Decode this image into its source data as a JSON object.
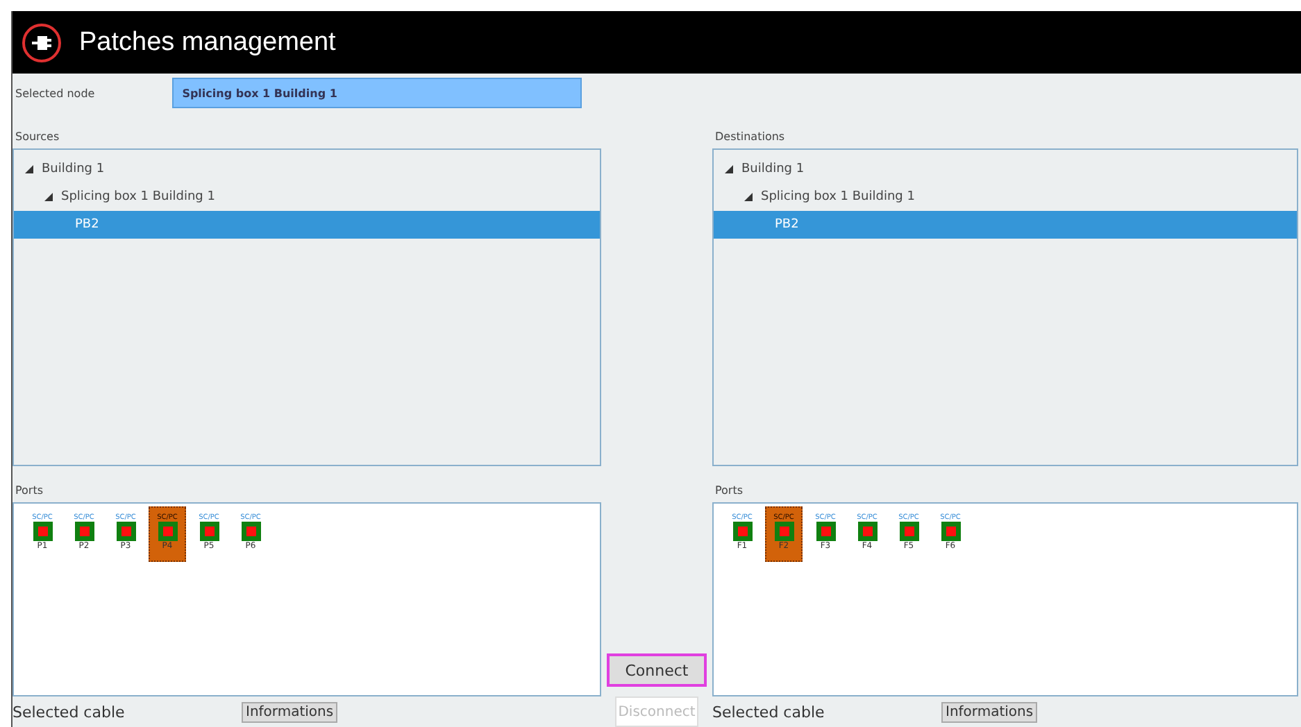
{
  "window": {
    "title": "Patches management"
  },
  "selected_node": {
    "label": "Selected node",
    "value": "Splicing box 1 Building 1"
  },
  "sources": {
    "label": "Sources",
    "tree": [
      {
        "label": "Building 1",
        "expanded": true,
        "selected": false,
        "children": [
          {
            "label": "Splicing box 1 Building 1",
            "expanded": true,
            "selected": false,
            "children": [
              {
                "label": "PB2",
                "selected": true
              }
            ]
          }
        ]
      }
    ],
    "ports_label": "Ports",
    "ports": [
      {
        "type": "SC/PC",
        "label": "P1",
        "selected": false
      },
      {
        "type": "SC/PC",
        "label": "P2",
        "selected": false
      },
      {
        "type": "SC/PC",
        "label": "P3",
        "selected": false
      },
      {
        "type": "SC/PC",
        "label": "P4",
        "selected": true
      },
      {
        "type": "SC/PC",
        "label": "P5",
        "selected": false
      },
      {
        "type": "SC/PC",
        "label": "P6",
        "selected": false
      }
    ],
    "cable_label": "Selected cable",
    "info_button": "Informations"
  },
  "destinations": {
    "label": "Destinations",
    "tree": [
      {
        "label": "Building 1",
        "expanded": true,
        "selected": false,
        "children": [
          {
            "label": "Splicing box 1 Building 1",
            "expanded": true,
            "selected": false,
            "children": [
              {
                "label": "PB2",
                "selected": true
              }
            ]
          }
        ]
      }
    ],
    "ports_label": "Ports",
    "ports": [
      {
        "type": "SC/PC",
        "label": "F1",
        "selected": false
      },
      {
        "type": "SC/PC",
        "label": "F2",
        "selected": true
      },
      {
        "type": "SC/PC",
        "label": "F3",
        "selected": false
      },
      {
        "type": "SC/PC",
        "label": "F4",
        "selected": false
      },
      {
        "type": "SC/PC",
        "label": "F5",
        "selected": false
      },
      {
        "type": "SC/PC",
        "label": "F6",
        "selected": false
      }
    ],
    "cable_label": "Selected cable",
    "info_button": "Informations"
  },
  "connect_button": {
    "label": "Connect",
    "disabled": false
  },
  "disconnect_button": {
    "label": "Disconnect",
    "disabled": true
  }
}
